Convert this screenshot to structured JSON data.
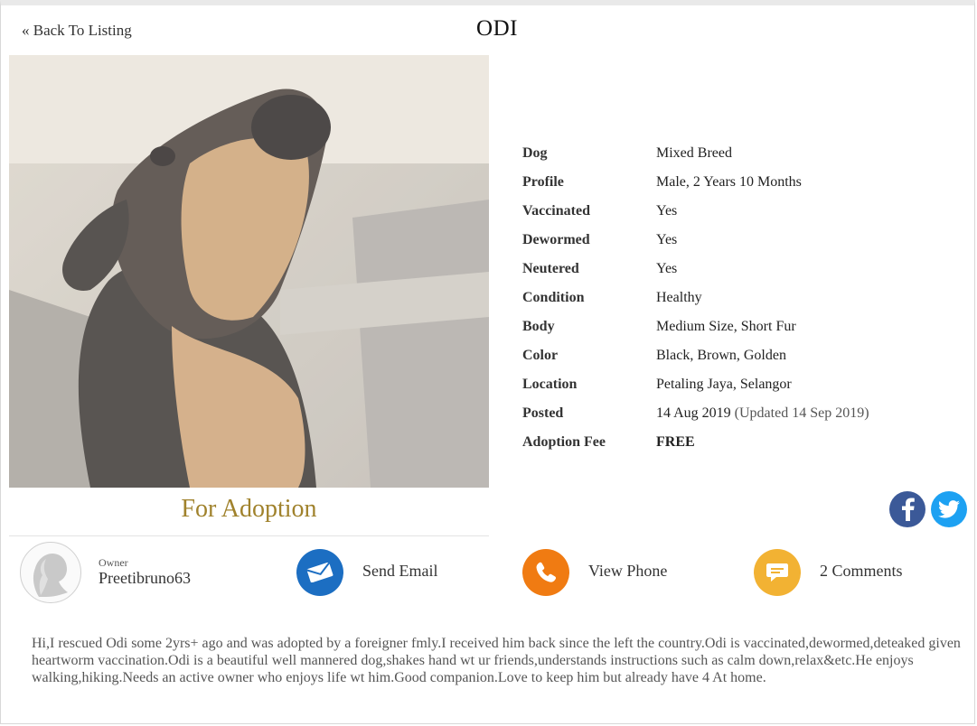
{
  "nav": {
    "back_label": "« Back To Listing"
  },
  "pet": {
    "name": "ODI",
    "status_caption": "For Adoption"
  },
  "details": [
    {
      "label": "Dog",
      "value": "Mixed Breed"
    },
    {
      "label": "Profile",
      "value": "Male, 2 Years 10 Months"
    },
    {
      "label": "Vaccinated",
      "value": "Yes"
    },
    {
      "label": "Dewormed",
      "value": "Yes"
    },
    {
      "label": "Neutered",
      "value": "Yes"
    },
    {
      "label": "Condition",
      "value": "Healthy"
    },
    {
      "label": "Body",
      "value": "Medium Size, Short Fur"
    },
    {
      "label": "Color",
      "value": "Black, Brown, Golden"
    },
    {
      "label": "Location",
      "value": "Petaling Jaya, Selangor"
    },
    {
      "label": "Posted",
      "value": "14 Aug 2019",
      "note": "(Updated 14 Sep 2019)"
    },
    {
      "label": "Adoption Fee",
      "value": "FREE"
    }
  ],
  "share": {
    "facebook_icon": "facebook-icon",
    "twitter_icon": "twitter-icon"
  },
  "owner": {
    "label": "Owner",
    "name": "Preetibruno63"
  },
  "actions": {
    "email": {
      "label": "Send Email",
      "icon": "envelope-icon",
      "color": "#1c6ec2"
    },
    "phone": {
      "label": "View Phone",
      "icon": "phone-icon",
      "color": "#f07b12"
    },
    "comments": {
      "label": "2 Comments",
      "icon": "comment-icon",
      "color": "#f2b233"
    }
  },
  "description": "Hi,I rescued Odi some 2yrs+ ago and was adopted by a foreigner fmly.I received him back since the left the country.Odi is vaccinated,dewormed,deteaked given heartworm vaccination.Odi is a beautiful well mannered dog,shakes hand wt ur friends,understands instructions such as calm down,relax&etc.He enjoys walking,hiking.Needs an active owner who enjoys life wt him.Good companion.Love to keep him but already have 4 At home.",
  "colors": {
    "fee_free": "#3a9f4e",
    "caption": "#a0822c"
  }
}
